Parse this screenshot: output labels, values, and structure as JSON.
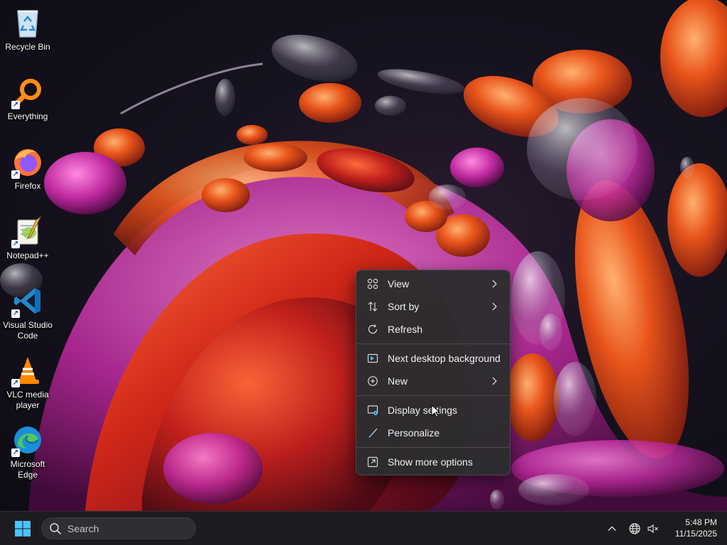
{
  "desktop": {
    "icons": [
      {
        "label": "Recycle Bin",
        "icon": "recycle-bin-icon",
        "shortcut": false
      },
      {
        "label": "Everything",
        "icon": "everything-search-icon",
        "shortcut": true
      },
      {
        "label": "Firefox",
        "icon": "firefox-icon",
        "shortcut": true
      },
      {
        "label": "Notepad++",
        "icon": "notepad-plus-plus-icon",
        "shortcut": true
      },
      {
        "label": "Visual Studio Code",
        "icon": "vscode-icon",
        "shortcut": true
      },
      {
        "label": "VLC media player",
        "icon": "vlc-icon",
        "shortcut": true
      },
      {
        "label": "Microsoft Edge",
        "icon": "edge-icon",
        "shortcut": true
      }
    ]
  },
  "context_menu": {
    "items": [
      {
        "label": "View",
        "icon": "view-grid-icon",
        "has_submenu": true
      },
      {
        "label": "Sort by",
        "icon": "sort-icon",
        "has_submenu": true
      },
      {
        "label": "Refresh",
        "icon": "refresh-icon",
        "has_submenu": false
      },
      {
        "label": "Next desktop background",
        "icon": "next-background-icon",
        "has_submenu": false
      },
      {
        "label": "New",
        "icon": "new-plus-icon",
        "has_submenu": true
      },
      {
        "label": "Display settings",
        "icon": "display-settings-icon",
        "has_submenu": false
      },
      {
        "label": "Personalize",
        "icon": "personalize-brush-icon",
        "has_submenu": false
      },
      {
        "label": "Show more options",
        "icon": "show-more-options-icon",
        "has_submenu": false
      }
    ]
  },
  "taskbar": {
    "search_placeholder": "Search",
    "clock": {
      "time": "5:48 PM",
      "date": "11/15/2025"
    }
  },
  "colors": {
    "accent": "#4cc2ff",
    "menu_bg": "#2c2c30",
    "taskbar_bg": "#1c1c20"
  }
}
